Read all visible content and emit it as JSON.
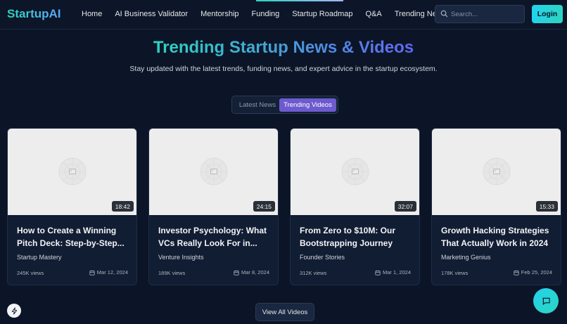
{
  "nav": {
    "brand": "StartupAI",
    "links": [
      "Home",
      "AI Business Validator",
      "Mentorship",
      "Funding",
      "Startup Roadmap",
      "Q&A",
      "Trending News"
    ],
    "search_placeholder": "Search...",
    "login_label": "Login"
  },
  "hero": {
    "title": "Trending Startup News & Videos",
    "subtitle": "Stay updated with the latest trends, funding news, and expert advice in the startup ecosystem."
  },
  "tabs": [
    {
      "label": "Latest News",
      "active": false
    },
    {
      "label": "Trending Videos",
      "active": true
    }
  ],
  "videos": [
    {
      "duration": "18:42",
      "title": "How to Create a Winning Pitch Deck: Step-by-Step...",
      "author": "Startup Mastery",
      "views": "245K views",
      "date": "Mar 12, 2024"
    },
    {
      "duration": "24:15",
      "title": "Investor Psychology: What VCs Really Look For in...",
      "author": "Venture Insights",
      "views": "189K views",
      "date": "Mar 8, 2024"
    },
    {
      "duration": "32:07",
      "title": "From Zero to $10M: Our Bootstrapping Journey",
      "author": "Founder Stories",
      "views": "312K views",
      "date": "Mar 1, 2024"
    },
    {
      "duration": "15:33",
      "title": "Growth Hacking Strategies That Actually Work in 2024",
      "author": "Marketing Genius",
      "views": "178K views",
      "date": "Feb 25, 2024"
    }
  ],
  "view_all_label": "View All Videos",
  "icons": {
    "search": "search-icon",
    "placeholder": "image-placeholder-icon",
    "calendar": "calendar-icon",
    "bolt": "bolt-icon",
    "chat": "chat-icon"
  },
  "colors": {
    "background": "#0b1527",
    "accent_teal": "#2dd4bf",
    "accent_indigo": "#6366f1",
    "active_tab": "#6d5acf"
  }
}
